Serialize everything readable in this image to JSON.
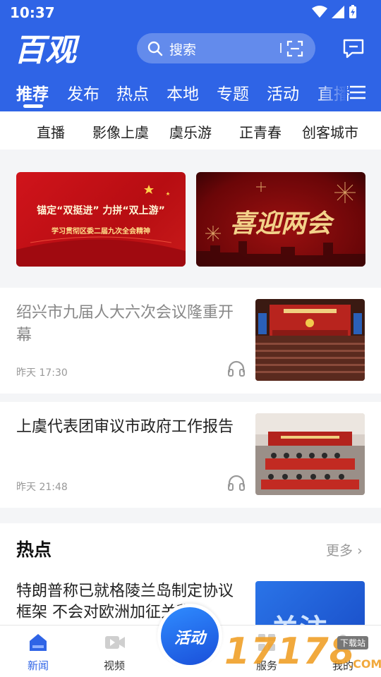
{
  "status_bar": {
    "time": "10:37"
  },
  "header": {
    "logo_text": "百观",
    "search_placeholder": "搜索"
  },
  "tabs": [
    {
      "label": "推荐",
      "active": true
    },
    {
      "label": "发布"
    },
    {
      "label": "热点"
    },
    {
      "label": "本地"
    },
    {
      "label": "专题"
    },
    {
      "label": "活动"
    },
    {
      "label": "直播"
    }
  ],
  "subnav": [
    "直播",
    "影像上虞",
    "虞乐游",
    "正青春",
    "创客城市"
  ],
  "banners": [
    {
      "title": "锚定“双挺进” 力拼“双上游”",
      "subtitle": "学习贯彻区委二届九次全会精神"
    },
    {
      "title": "喜迎两会"
    }
  ],
  "news": [
    {
      "title": "绍兴市九届人大六次会议隆重开幕",
      "time": "昨天 17:30",
      "read": true
    },
    {
      "title": "上虞代表团审议市政府工作报告",
      "time": "昨天 21:48",
      "read": false
    }
  ],
  "hot": {
    "title": "热点",
    "more": "更多",
    "item": {
      "title": "特朗普称已就格陵兰岛制定协议框架 不会对欧洲加征关税",
      "thumb_text": "关注"
    }
  },
  "bottom_nav": [
    {
      "label": "新闻",
      "icon": "news-icon",
      "active": true
    },
    {
      "label": "视频",
      "icon": "video-icon"
    },
    {
      "label": "活动",
      "icon": "activity-icon"
    },
    {
      "label": "服务",
      "icon": "service-icon"
    },
    {
      "label": "我的",
      "icon": "profile-icon"
    }
  ],
  "watermark": {
    "digits": "17178",
    "tag": "下载站",
    "suffix": ".COM"
  },
  "colors": {
    "brand": "#2f64e6",
    "banner_red": "#d0141b",
    "watermark": "#f0a028"
  }
}
